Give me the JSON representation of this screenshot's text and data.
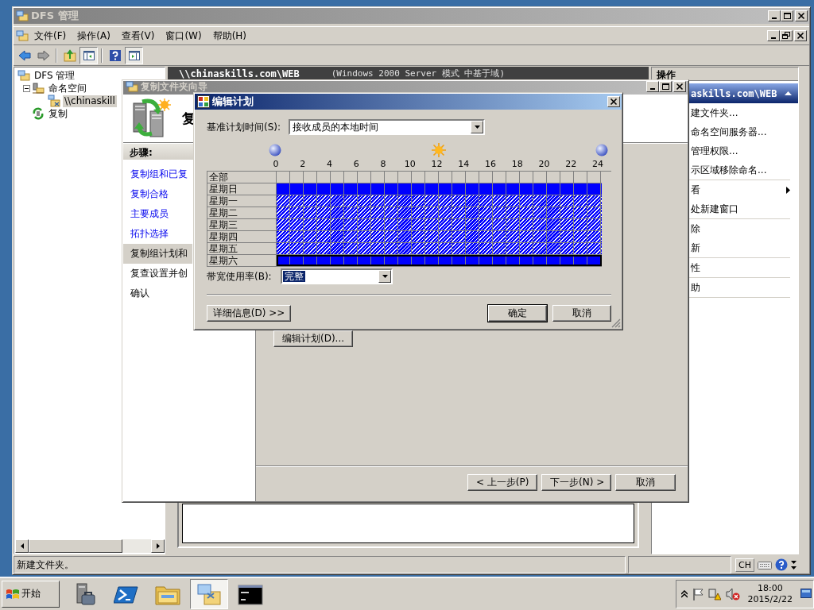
{
  "main_window": {
    "title": "DFS 管理",
    "menu": [
      {
        "label": "文件(F)"
      },
      {
        "label": "操作(A)"
      },
      {
        "label": "查看(V)"
      },
      {
        "label": "窗口(W)"
      },
      {
        "label": "帮助(H)"
      }
    ],
    "toolbar": [
      [
        {
          "kind": "back",
          "pressed": false
        },
        {
          "kind": "forward",
          "pressed": false
        }
      ],
      [
        {
          "kind": "up",
          "pressed": false
        },
        {
          "kind": "tree-pane",
          "pressed": true
        }
      ],
      [
        {
          "kind": "help",
          "pressed": false
        },
        {
          "kind": "action-pane",
          "pressed": true
        }
      ]
    ],
    "tree": [
      {
        "label": "DFS 管理",
        "kind": "root",
        "selected": false,
        "children": [
          {
            "label": "命名空间",
            "kind": "namespaces",
            "selected": false,
            "expanded": true,
            "children": [
              {
                "label": "\\\\chinaskill",
                "kind": "namespace",
                "selected": true
              }
            ]
          },
          {
            "label": "复制",
            "kind": "replication",
            "selected": false
          }
        ]
      }
    ],
    "center": {
      "path": "\\\\chinaskills.com\\WEB",
      "mode": "(Windows 2000 Server 模式 中基于域)"
    },
    "actions": {
      "title": "操作",
      "section": "askills.com\\WEB",
      "groups": [
        [
          {
            "label": "建文件夹...",
            "submenu": false
          },
          {
            "label": "命名空间服务器...",
            "submenu": false
          },
          {
            "label": "管理权限...",
            "submenu": false
          },
          {
            "label": "示区域移除命名...",
            "submenu": false
          }
        ],
        [
          {
            "label": "看",
            "submenu": true
          },
          {
            "label": "处新建窗口",
            "submenu": false
          }
        ],
        [
          {
            "label": "除",
            "submenu": false
          },
          {
            "label": "新",
            "submenu": false
          }
        ],
        [
          {
            "label": "性",
            "submenu": false
          }
        ],
        [
          {
            "label": "助",
            "submenu": false
          }
        ]
      ]
    },
    "status_bar": {
      "text": "新建文件夹。",
      "language": "CH"
    }
  },
  "wizard": {
    "title": "复制文件夹向导",
    "heading": "复",
    "steps_title": "步骤:",
    "steps": [
      {
        "label": "复制组和已复",
        "done": true,
        "selected": false
      },
      {
        "label": "复制合格",
        "done": true,
        "selected": false
      },
      {
        "label": "主要成员",
        "done": true,
        "selected": false
      },
      {
        "label": "拓扑选择",
        "done": true,
        "selected": false
      },
      {
        "label": "复制组计划和",
        "done": false,
        "selected": true
      },
      {
        "label": "复查设置并创",
        "done": false,
        "selected": false
      },
      {
        "label": "确认",
        "done": false,
        "selected": false
      }
    ],
    "edit_button": "编辑计划(D)...",
    "buttons": [
      {
        "label": "< 上一步(P)"
      },
      {
        "label": "下一步(N) >"
      },
      {
        "label": "取消"
      }
    ]
  },
  "schedule_dialog": {
    "title": "编辑计划",
    "base_label": "基准计划时间(S):",
    "base_value": "接收成员的本地时间",
    "hours": [
      "0",
      "2",
      "4",
      "6",
      "8",
      "10",
      "12",
      "14",
      "16",
      "18",
      "20",
      "22",
      "24"
    ],
    "all_label": "全部",
    "days": [
      {
        "label": "星期日",
        "selected": false,
        "focused": false
      },
      {
        "label": "星期一",
        "selected": true,
        "focused": false
      },
      {
        "label": "星期二",
        "selected": true,
        "focused": false
      },
      {
        "label": "星期三",
        "selected": true,
        "focused": false
      },
      {
        "label": "星期四",
        "selected": true,
        "focused": false
      },
      {
        "label": "星期五",
        "selected": true,
        "focused": false
      },
      {
        "label": "星期六",
        "selected": false,
        "focused": true
      }
    ],
    "bandwidth_label": "带宽使用率(B):",
    "bandwidth_value": "完整",
    "details_button": "详细信息(D) >>",
    "ok_button": "确定",
    "cancel_button": "取消"
  },
  "taskbar": {
    "start": "开始",
    "apps": [
      {
        "kind": "server-manager",
        "active": false
      },
      {
        "kind": "powershell",
        "active": false
      },
      {
        "kind": "explorer",
        "active": false
      },
      {
        "kind": "dfs",
        "active": true
      },
      {
        "kind": "console",
        "active": false
      }
    ],
    "time": "18:00",
    "date": "2015/2/22"
  }
}
